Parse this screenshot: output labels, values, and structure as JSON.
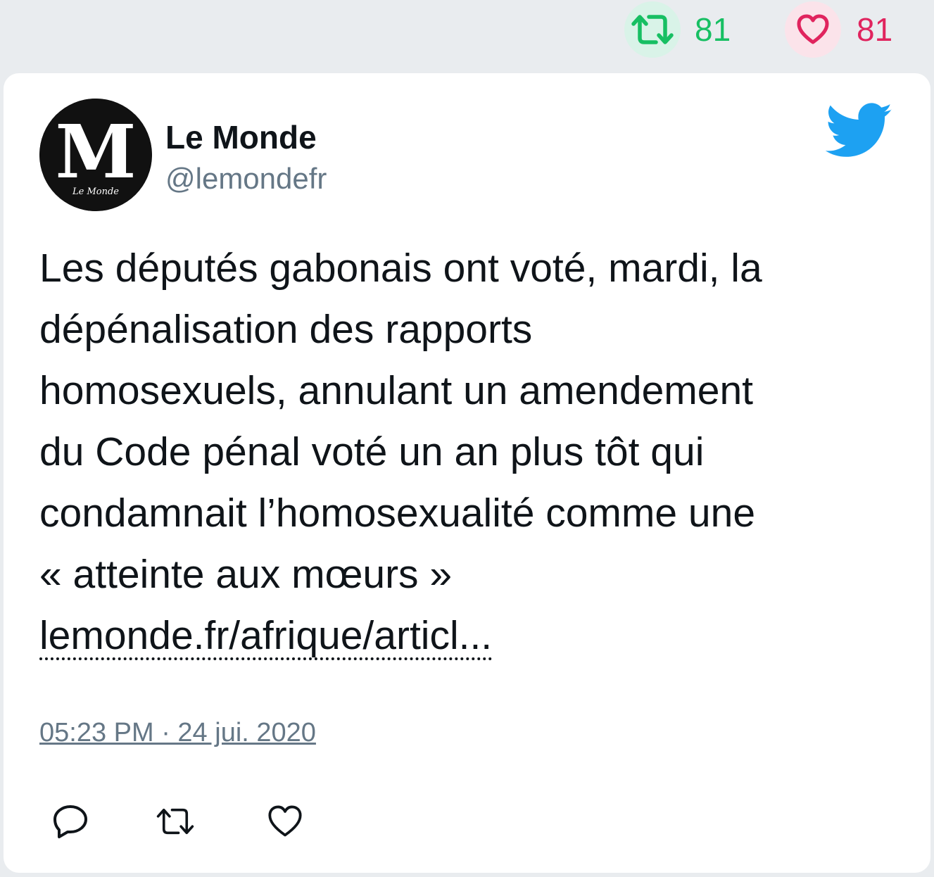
{
  "stats": {
    "retweet_count": "81",
    "like_count": "81"
  },
  "author": {
    "name": "Le Monde",
    "handle": "@lemondefr",
    "avatar_logo": "Le Monde"
  },
  "tweet": {
    "lines": [
      "Les députés gabonais ont voté, mardi, la",
      "dépénalisation des rapports",
      "homosexuels, annulant un amendement",
      "du Code pénal voté un an plus tôt qui",
      "condamnait l’homosexualité comme une",
      "« atteinte aux mœurs »"
    ],
    "link": "lemonde.fr/afrique/articl..."
  },
  "timestamp": "05:23 PM · 24 jui. 2020",
  "icons": {
    "retweet": "retweet-icon",
    "like": "heart-icon",
    "reply": "reply-icon",
    "brand": "twitter-bird-icon"
  },
  "colors": {
    "retweet_green": "#17bf63",
    "like_red": "#e0245e",
    "twitter_blue": "#1da1f2",
    "muted_gray": "#657786",
    "background": "#e9ecef"
  }
}
